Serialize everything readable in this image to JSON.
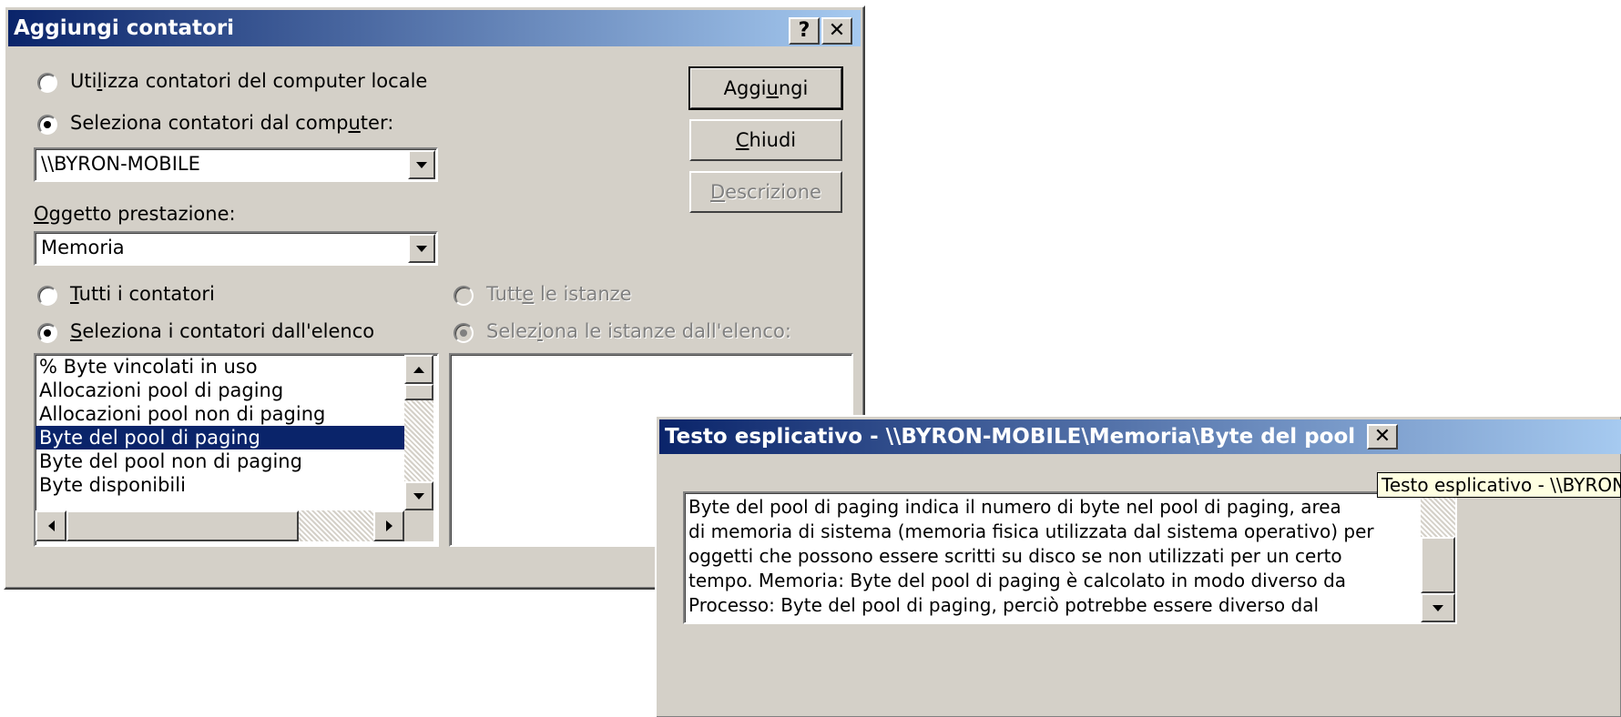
{
  "add_counters": {
    "title": "Aggiungi contatori",
    "help_label": "?",
    "close_label": "✕",
    "radio_local": {
      "pre": "Uti",
      "key": "l",
      "post": "izza contatori del computer locale",
      "checked": false
    },
    "radio_select_computer": {
      "pre": "Seleziona contatori dal comp",
      "key": "u",
      "post": "ter:",
      "checked": true
    },
    "computer_value": "\\\\BYRON-MOBILE",
    "object_label": {
      "key": "O",
      "post": "ggetto prestazione:"
    },
    "object_value": "Memoria",
    "radio_all_counters": {
      "key": "T",
      "post": "utti i contatori",
      "checked": false
    },
    "radio_select_counters": {
      "key": "S",
      "post": "eleziona i contatori dall'elenco",
      "checked": true
    },
    "radio_all_instances": {
      "pre": "Tutt",
      "key": "e",
      "post": " le istanze",
      "checked": false,
      "enabled": false
    },
    "radio_select_instances": {
      "pre": "Selez",
      "key": "i",
      "post": "ona le istanze dall'elenco:",
      "checked": true,
      "enabled": false
    },
    "counters": [
      "% Byte vincolati in uso",
      "Allocazioni pool di paging",
      "Allocazioni pool non di paging",
      "Byte del pool di paging",
      "Byte del pool non di paging",
      "Byte disponibili"
    ],
    "selected_counter_index": 3,
    "buttons": {
      "add": {
        "pre": "Aggi",
        "key": "u",
        "post": "ngi"
      },
      "close": {
        "pre": "",
        "key": "C",
        "post": "hiudi"
      },
      "description": {
        "pre": "",
        "key": "D",
        "post": "escrizione",
        "enabled": false
      }
    }
  },
  "explain_dialog": {
    "title": "Testo esplicativo - \\\\BYRON-MOBILE\\Memoria\\Byte del pool di p...",
    "close_label": "✕",
    "text": "Byte del pool di paging indica il numero di byte nel pool di paging, area\ndi memoria di sistema (memoria fisica utilizzata dal sistema operativo) per\noggetti che possono essere scritti su disco se non utilizzati per un certo\ntempo. Memoria: Byte del pool di paging è calcolato in modo diverso da\nProcesso: Byte del pool di paging, perciò potrebbe essere diverso dal",
    "tooltip": "Testo esplicativo - \\\\BYRON-MOBILE\\Memoria\\Byte del pool di paging"
  },
  "colors": {
    "title_gradient_start": "#0a246a",
    "title_gradient_end": "#a6caf0",
    "selection": "#0a246a",
    "face": "#d4d0c8",
    "tooltip_bg": "#ffffe1"
  }
}
